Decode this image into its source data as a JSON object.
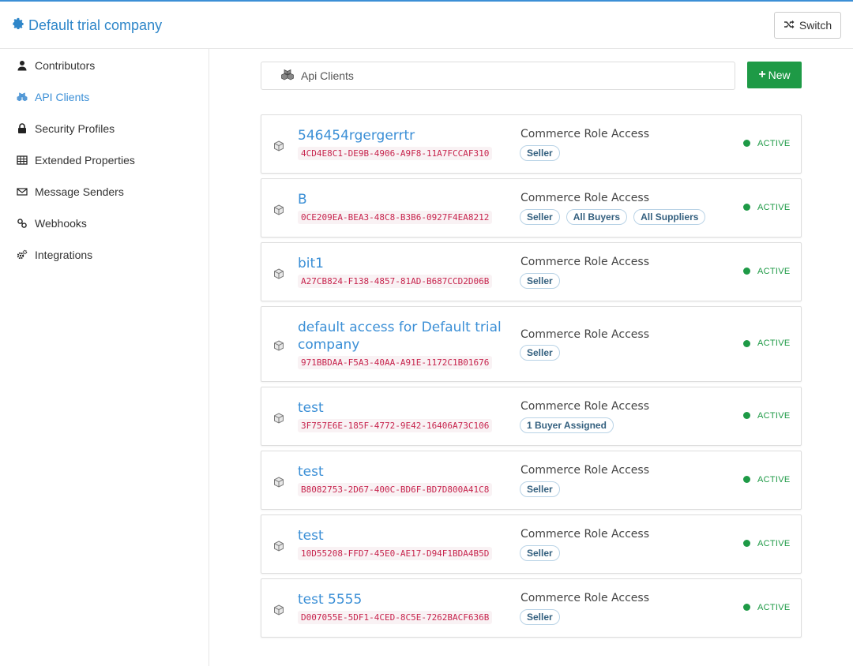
{
  "header": {
    "brand": "Default trial company",
    "switch_label": "Switch"
  },
  "sidebar": {
    "items": [
      {
        "label": "Contributors",
        "icon": "user-icon"
      },
      {
        "label": "API Clients",
        "icon": "cubes-icon",
        "active": true
      },
      {
        "label": "Security Profiles",
        "icon": "lock-icon"
      },
      {
        "label": "Extended Properties",
        "icon": "table-icon"
      },
      {
        "label": "Message Senders",
        "icon": "envelope-icon"
      },
      {
        "label": "Webhooks",
        "icon": "link-icon"
      },
      {
        "label": "Integrations",
        "icon": "cogs-icon"
      }
    ]
  },
  "search": {
    "label": "Api Clients"
  },
  "toolbar": {
    "new_label": "New"
  },
  "clients": [
    {
      "name": "546454rgergerrtr",
      "id": "4CD4E8C1-DE9B-4906-A9F8-11A7FCCAF310",
      "role_title": "Commerce Role Access",
      "badges": [
        "Seller"
      ],
      "status": "ACTIVE"
    },
    {
      "name": "B",
      "id": "0CE209EA-BEA3-48C8-B3B6-0927F4EA8212",
      "role_title": "Commerce Role Access",
      "badges": [
        "Seller",
        "All Buyers",
        "All Suppliers"
      ],
      "status": "ACTIVE"
    },
    {
      "name": "bit1",
      "id": "A27CB824-F138-4857-81AD-B687CCD2D06B",
      "role_title": "Commerce Role Access",
      "badges": [
        "Seller"
      ],
      "status": "ACTIVE"
    },
    {
      "name": "default access for Default trial company",
      "id": "971BBDAA-F5A3-40AA-A91E-1172C1B01676",
      "role_title": "Commerce Role Access",
      "badges": [
        "Seller"
      ],
      "status": "ACTIVE"
    },
    {
      "name": "test",
      "id": "3F757E6E-185F-4772-9E42-16406A73C106",
      "role_title": "Commerce Role Access",
      "badges": [
        "1 Buyer Assigned"
      ],
      "status": "ACTIVE"
    },
    {
      "name": "test",
      "id": "B8082753-2D67-400C-BD6F-BD7D800A41C8",
      "role_title": "Commerce Role Access",
      "badges": [
        "Seller"
      ],
      "status": "ACTIVE"
    },
    {
      "name": "test",
      "id": "10D55208-FFD7-45E0-AE17-D94F1BDA4B5D",
      "role_title": "Commerce Role Access",
      "badges": [
        "Seller"
      ],
      "status": "ACTIVE"
    },
    {
      "name": "test 5555",
      "id": "D007055E-5DF1-4CED-8C5E-7262BACF636B",
      "role_title": "Commerce Role Access",
      "badges": [
        "Seller"
      ],
      "status": "ACTIVE"
    }
  ]
}
